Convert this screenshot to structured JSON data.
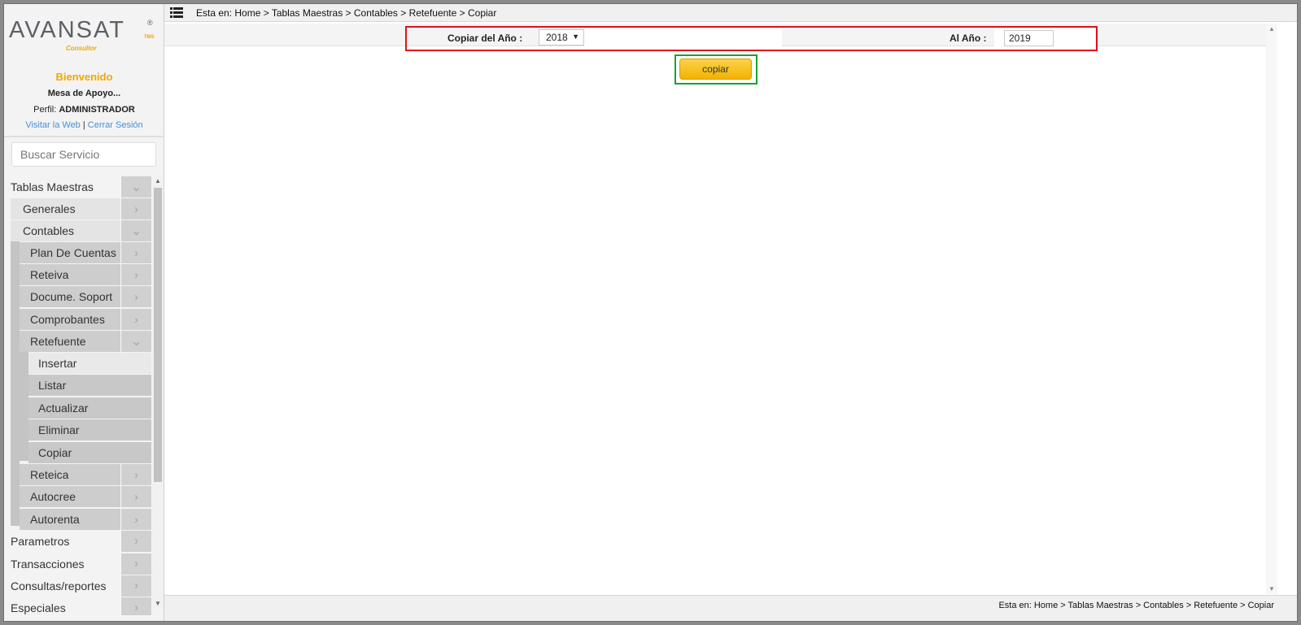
{
  "brand": {
    "name": "AVANSAT",
    "registered": "®",
    "suffix": "TMS",
    "subtitle": "Consultor"
  },
  "user": {
    "welcome": "Bienvenido",
    "name": "Mesa de Apoyo...",
    "profile_label": "Perfil:",
    "profile_value": "ADMINISTRADOR",
    "link_web": "Visitar la Web",
    "link_sep": "|",
    "link_logout": "Cerrar Sesión"
  },
  "search": {
    "placeholder": "Buscar Servicio"
  },
  "menu": {
    "tablas_maestras": "Tablas Maestras",
    "generales": "Generales",
    "contables": "Contables",
    "plan_de_cuentas": "Plan De Cuentas",
    "reteiva": "Reteiva",
    "docume_soport": "Docume. Soport",
    "comprobantes": "Comprobantes",
    "retefuente": "Retefuente",
    "insertar": "Insertar",
    "listar": "Listar",
    "actualizar": "Actualizar",
    "eliminar": "Eliminar",
    "copiar": "Copiar",
    "reteica": "Reteica",
    "autocree": "Autocree",
    "autorenta": "Autorenta",
    "parametros": "Parametros",
    "transacciones": "Transacciones",
    "consultas": "Consultas/reportes",
    "especiales": "Especiales"
  },
  "breadcrumb": {
    "top": "Esta en: Home > Tablas Maestras > Contables > Retefuente > Copiar",
    "bottom": "Esta en: Home > Tablas Maestras > Contables > Retefuente > Copiar"
  },
  "form": {
    "from_label": "Copiar del Año :",
    "from_value": "2018",
    "to_label": "Al Año :",
    "to_value": "2019",
    "submit_label": "copiar"
  },
  "colors": {
    "accent": "#f0a800",
    "link": "#4a8fd6",
    "highlight_form": "#e0101a",
    "highlight_button": "#1aa232"
  }
}
